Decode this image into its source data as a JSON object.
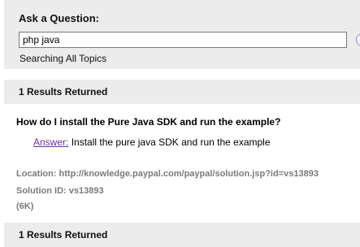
{
  "ask": {
    "title": "Ask a Question:",
    "query": "php java",
    "scope": "Searching All Topics",
    "clear_icon": "close-icon"
  },
  "results": [
    {
      "count_label": "1 Results Returned",
      "question": "How do I install the Pure Java SDK and run the example?",
      "answer_label": "Answer:",
      "answer_text": " Install the pure java SDK and run the example",
      "location": "Location: http://knowledge.paypal.com/paypal/solution.jsp?id=vs13893",
      "solution_id": "Solution ID: vs13893",
      "size": "(6K)"
    },
    {
      "count_label": "1 Results Returned"
    }
  ],
  "colors": {
    "panel_bg": "#ececec",
    "link_visited": "#6633a0",
    "meta_text": "#7a7a7a"
  }
}
